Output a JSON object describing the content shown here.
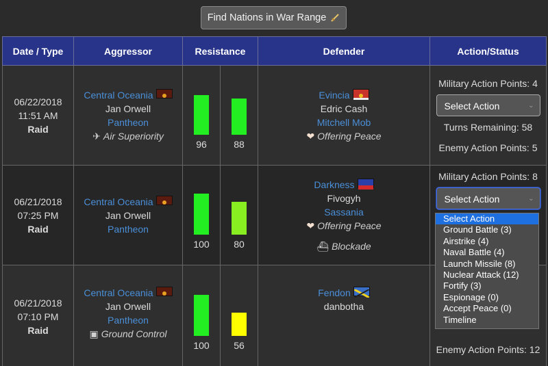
{
  "top": {
    "find_button": "Find Nations in War Range"
  },
  "headers": [
    "Date / Type",
    "Aggressor",
    "Resistance",
    "Defender",
    "Action/Status"
  ],
  "wars": [
    {
      "date": "06/22/2018",
      "time": "11:51 AM",
      "type": "Raid",
      "aggressor": {
        "nation": "Central Oceania",
        "leader": "Jan Orwell",
        "alliance": "Pantheon",
        "status": "Air Superiority"
      },
      "resistance": {
        "aggressor": 96,
        "defender": 88
      },
      "defender": {
        "nation": "Evincia",
        "leader": "Edric Cash",
        "alliance": "Mitchell Mob",
        "status": "Offering Peace"
      },
      "action": {
        "map": "Military Action Points: 4",
        "select": "Select Action",
        "turns": "Turns Remaining: 58",
        "enemy_map": "Enemy Action Points: 5"
      }
    },
    {
      "date": "06/21/2018",
      "time": "07:25 PM",
      "type": "Raid",
      "aggressor": {
        "nation": "Central Oceania",
        "leader": "Jan Orwell",
        "alliance": "Pantheon"
      },
      "resistance": {
        "aggressor": 100,
        "defender": 80
      },
      "defender": {
        "nation": "Darkness",
        "leader": "Fivogyh",
        "alliance": "Sassania",
        "status": "Offering Peace",
        "status2": "Blockade"
      },
      "action": {
        "map": "Military Action Points: 8",
        "select": "Select Action"
      }
    },
    {
      "date": "06/21/2018",
      "time": "07:10 PM",
      "type": "Raid",
      "aggressor": {
        "nation": "Central Oceania",
        "leader": "Jan Orwell",
        "alliance": "Pantheon",
        "status": "Ground Control"
      },
      "resistance": {
        "aggressor": 100,
        "defender": 56
      },
      "defender": {
        "nation": "Fendon",
        "leader": "danbotha"
      },
      "action": {
        "enemy_map": "Enemy Action Points: 12"
      }
    }
  ],
  "dropdown_options": [
    "Select Action",
    "Ground Battle (3)",
    "Airstrike (4)",
    "Naval Battle (4)",
    "Launch Missile (8)",
    "Nuclear Attack (12)",
    "Fortify (3)",
    "Espionage (0)",
    "Accept Peace (0)",
    "Timeline"
  ],
  "colors": {
    "header_bg": "#28348a",
    "link": "#4a8fd8",
    "bar_high": "#22ee22",
    "bar_mid": "#88ee22",
    "bar_low": "#ffff00",
    "dropdown_selected": "#1e6fe0"
  },
  "icons": {
    "air_superiority": "airplane-icon",
    "offering_peace": "broken-heart-icon",
    "blockade": "ship-icon",
    "ground_control": "tank-icon",
    "find_button": "sword-icon"
  }
}
